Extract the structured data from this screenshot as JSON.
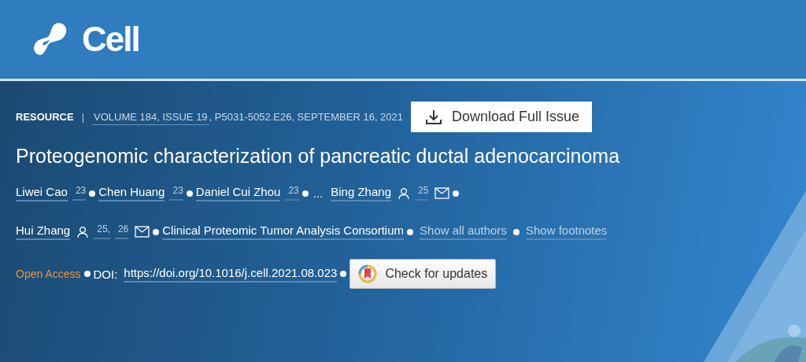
{
  "journal": {
    "name": "Cell"
  },
  "article_type": "RESOURCE",
  "separator": "|",
  "citation": {
    "issue_link": "VOLUME 184, ISSUE 19",
    "rest": ", P5031-5052.E26, SEPTEMBER 16, 2021"
  },
  "download_button": "Download Full Issue",
  "title": "Proteogenomic characterization of pancreatic ductal adenocarcinoma",
  "authors": [
    {
      "kind": "author",
      "name": "Liwei Cao",
      "refs": [
        "23"
      ],
      "contact": false,
      "email": false
    },
    {
      "kind": "author",
      "name": "Chen Huang",
      "refs": [
        "23"
      ],
      "contact": false,
      "email": false
    },
    {
      "kind": "author",
      "name": "Daniel Cui Zhou",
      "refs": [
        "23"
      ],
      "contact": false,
      "email": false
    },
    {
      "kind": "ellipsis",
      "name": "..."
    },
    {
      "kind": "author",
      "name": "Bing Zhang",
      "refs": [
        "25"
      ],
      "contact": true,
      "email": true
    },
    {
      "kind": "author",
      "name": "Hui Zhang",
      "refs": [
        "25,",
        "26"
      ],
      "contact": true,
      "email": true
    },
    {
      "kind": "author",
      "name": "Clinical Proteomic Tumor Analysis Consortium",
      "contact": false,
      "email": false
    }
  ],
  "author_links": [
    "Show all authors",
    "Show footnotes"
  ],
  "access": "Open Access",
  "doi": {
    "label": "DOI:",
    "link": "https://doi.org/10.1016/j.cell.2021.08.023"
  },
  "updates_button": "Check for updates"
}
